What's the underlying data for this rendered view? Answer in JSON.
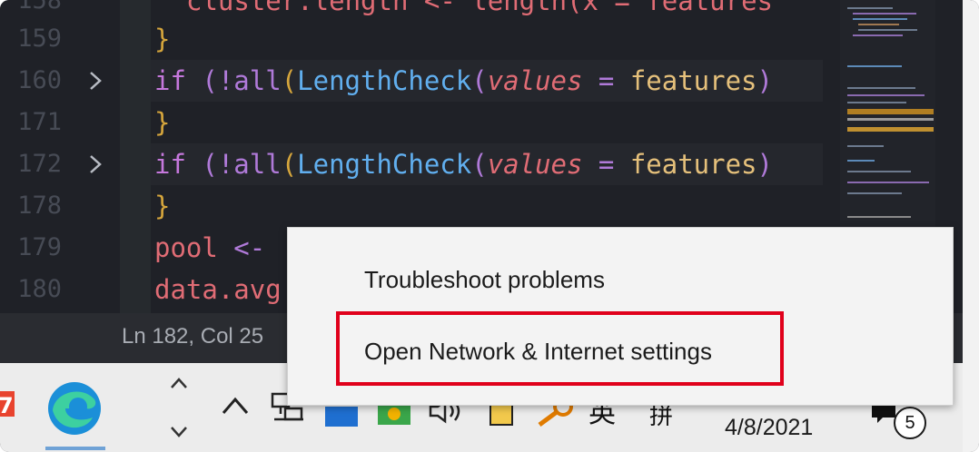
{
  "editor": {
    "lines": [
      {
        "num": "159",
        "text": "}"
      },
      {
        "num": "160",
        "text": "if (!all(LengthCheck(values = features)"
      },
      {
        "num": "171",
        "text": "}"
      },
      {
        "num": "172",
        "text": "if (!all(LengthCheck(values = features)"
      },
      {
        "num": "178",
        "text": "}"
      },
      {
        "num": "179",
        "text": "pool <-"
      },
      {
        "num": "180",
        "text": "data.avg"
      }
    ],
    "partial_top_line": "cluster.length <- length(x = features",
    "tokens": {
      "brace": "}",
      "kw_if": "if",
      "paren_open": " (",
      "bang_all": "!all",
      "paren2": "(",
      "fn_lengthcheck": "LengthCheck",
      "paren3": "(",
      "param_values": "values",
      "eq": " = ",
      "var_features": "features",
      "paren_close": ")",
      "pool_var": "pool",
      "assign": " <-",
      "data_avg": "data.avg"
    }
  },
  "statusbar": {
    "position": "Ln 182, Col 25"
  },
  "context_menu": {
    "items": [
      {
        "label": "Troubleshoot problems"
      },
      {
        "label": "Open Network & Internet settings"
      }
    ],
    "highlighted_index": 1,
    "highlight_color": "#e0001b"
  },
  "taskbar": {
    "clock_date": "4/8/2021",
    "notification_count": "5",
    "tray_icons": [
      "chevron-up-icon",
      "network-icon",
      "app-icon",
      "shield-icon",
      "speaker-icon",
      "usb-icon",
      "key-icon",
      "ime-english-icon",
      "ime-pinyin-icon"
    ],
    "ime_label_1": "英",
    "ime_label_2": "拼"
  }
}
